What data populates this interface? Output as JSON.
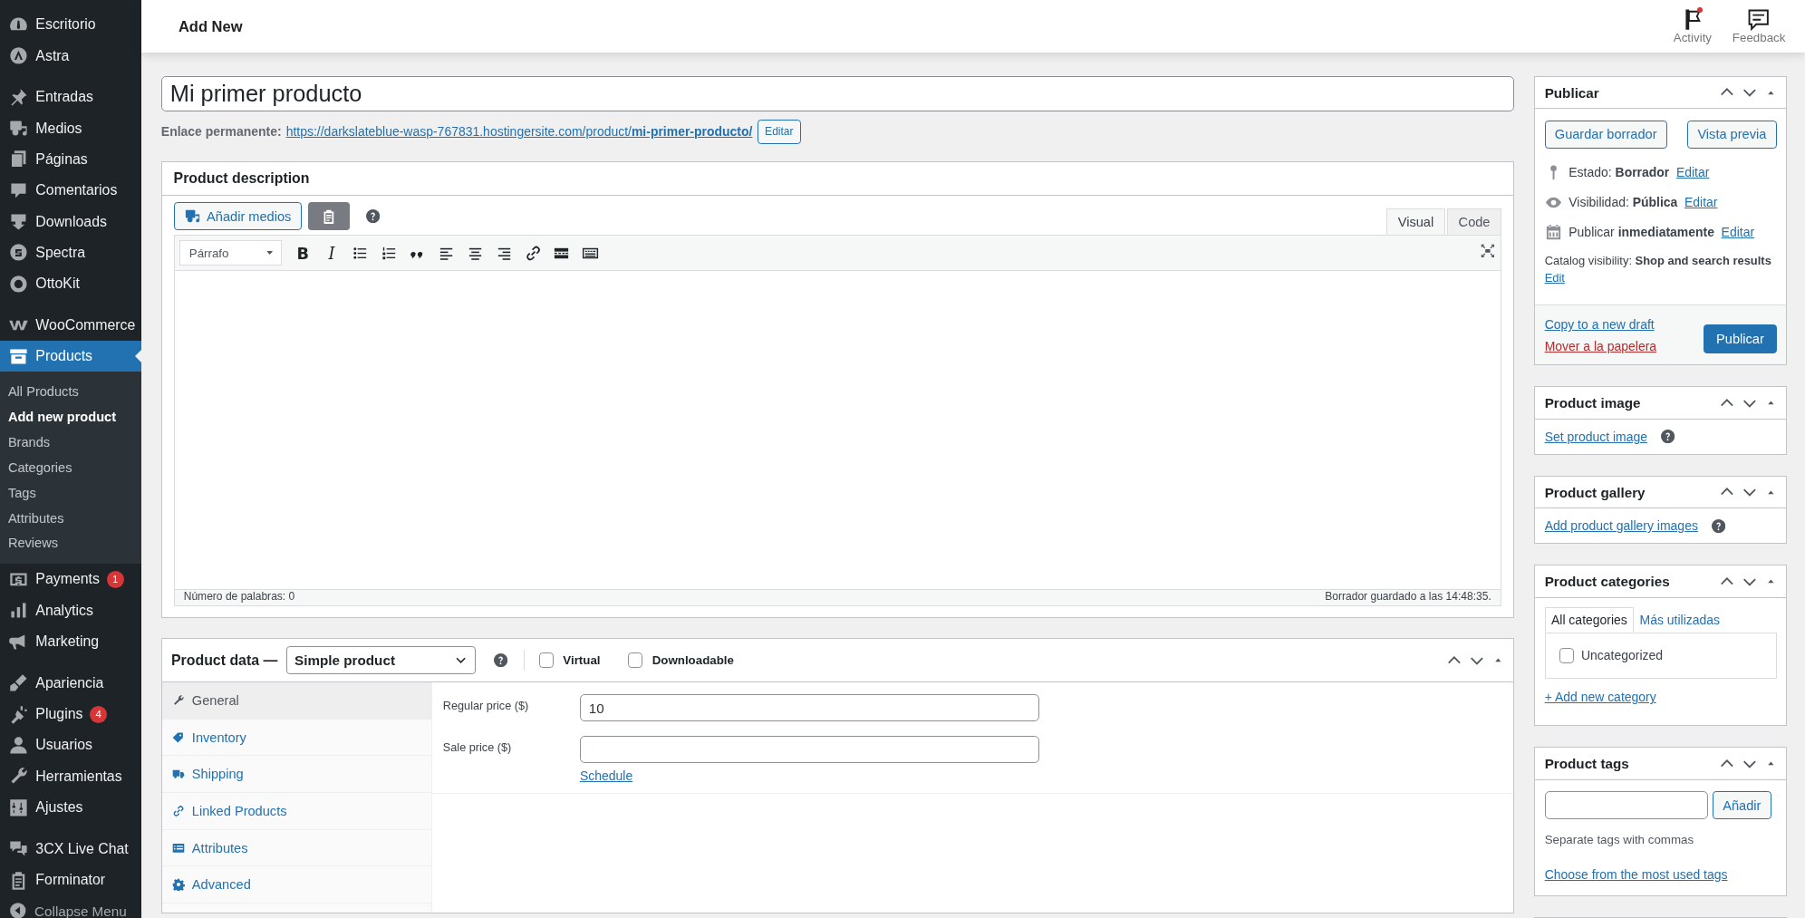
{
  "topbar": {
    "title": "Add New",
    "actions": [
      {
        "label": "Activity",
        "notification": true
      },
      {
        "label": "Feedback",
        "notification": false
      }
    ]
  },
  "sidebar": {
    "groups": [
      {
        "items": [
          {
            "label": "Escritorio",
            "selected": false
          },
          {
            "label": "Astra",
            "selected": false
          }
        ]
      },
      {
        "items": [
          {
            "label": "Entradas",
            "selected": false
          },
          {
            "label": "Medios",
            "selected": false
          },
          {
            "label": "Páginas",
            "selected": false
          },
          {
            "label": "Comentarios",
            "selected": false
          },
          {
            "label": "Downloads",
            "selected": false
          },
          {
            "label": "Spectra",
            "selected": false
          },
          {
            "label": "OttoKit",
            "selected": false
          }
        ]
      },
      {
        "items": [
          {
            "label": "WooCommerce",
            "selected": false
          },
          {
            "label": "Products",
            "selected": true,
            "children": [
              {
                "label": "All Products",
                "selected": false
              },
              {
                "label": "Add new product",
                "selected": true
              },
              {
                "label": "Brands",
                "selected": false
              },
              {
                "label": "Categories",
                "selected": false
              },
              {
                "label": "Tags",
                "selected": false
              },
              {
                "label": "Attributes",
                "selected": false
              },
              {
                "label": "Reviews",
                "selected": false
              }
            ]
          },
          {
            "label": "Payments",
            "selected": false,
            "badge": "1"
          },
          {
            "label": "Analytics",
            "selected": false
          },
          {
            "label": "Marketing",
            "selected": false
          }
        ]
      },
      {
        "items": [
          {
            "label": "Apariencia",
            "selected": false
          },
          {
            "label": "Plugins",
            "selected": false,
            "badge": "4"
          },
          {
            "label": "Usuarios",
            "selected": false
          },
          {
            "label": "Herramientas",
            "selected": false
          },
          {
            "label": "Ajustes",
            "selected": false
          }
        ]
      },
      {
        "items": [
          {
            "label": "3CX Live Chat",
            "selected": false
          },
          {
            "label": "Forminator",
            "selected": false
          }
        ]
      }
    ],
    "collapse": "Collapse Menu"
  },
  "title_field": {
    "value": "Mi primer producto"
  },
  "permalink": {
    "label": "Enlace permanente:",
    "url": "https://darkslateblue-wasp-767831.hostingersite.com/product/**mi-primer-producto/**",
    "button": "Editar"
  },
  "description": {
    "title": "Product description",
    "add_media": "Añadir medios",
    "tabs": [
      {
        "label": "Visual",
        "selected": true
      },
      {
        "label": "Code",
        "selected": false
      }
    ],
    "format": "Párrafo",
    "toolbar": [
      {
        "kind": "bold",
        "label": "B"
      },
      {
        "kind": "italic",
        "label": "I"
      },
      {
        "kind": "bullets"
      },
      {
        "kind": "numbers"
      },
      {
        "kind": "quote"
      },
      {
        "kind": "align-left"
      },
      {
        "kind": "align-center"
      },
      {
        "kind": "align-right"
      },
      {
        "kind": "link"
      },
      {
        "kind": "more"
      },
      {
        "kind": "toolbar"
      }
    ],
    "word_count": "Número de palabras: 0",
    "saved": "Borrador guardado a las 14:48:35."
  },
  "product_data": {
    "title": "Product data —",
    "type": "Simple product",
    "options": [
      {
        "label": "Virtual",
        "checked": false
      },
      {
        "label": "Downloadable",
        "checked": false
      }
    ],
    "tabs": [
      {
        "label": "General",
        "selected": true
      },
      {
        "label": "Inventory",
        "selected": false
      },
      {
        "label": "Shipping",
        "selected": false
      },
      {
        "label": "Linked Products",
        "selected": false
      },
      {
        "label": "Attributes",
        "selected": false
      },
      {
        "label": "Advanced",
        "selected": false
      }
    ],
    "fields": [
      {
        "label": "Regular price ($)",
        "value": "10"
      },
      {
        "label": "Sale price ($)",
        "link": "Schedule"
      }
    ]
  },
  "publish": {
    "title": "Publicar",
    "save_draft": "Guardar borrador",
    "preview": "Vista previa",
    "rows": [
      {
        "kind": "status",
        "text": "Estado: **Borrador**",
        "link": "Editar"
      },
      {
        "kind": "visibility",
        "text": "Visibilidad: **Pública**",
        "link": "Editar"
      },
      {
        "kind": "schedule",
        "text": "Publicar **inmediatamente**",
        "link": "Editar"
      },
      {
        "kind": "catalog",
        "text": "Catalog visibility: **Shop and search results**",
        "link": "Edit"
      }
    ],
    "copy_link": "Copy to a new draft",
    "trash_link": "Mover a la papelera",
    "publish_button": "Publicar"
  },
  "product_image": {
    "title": "Product image",
    "link": "Set product image"
  },
  "product_gallery": {
    "title": "Product gallery",
    "link": "Add product gallery images"
  },
  "product_categories": {
    "title": "Product categories",
    "tabs": [
      {
        "label": "All categories",
        "selected": true
      },
      {
        "label": "Más utilizadas",
        "selected": false
      }
    ],
    "categories": [
      {
        "label": "Uncategorized",
        "checked": false
      }
    ],
    "add_link": "+ Add new category"
  },
  "product_tags": {
    "title": "Product tags",
    "add_button": "Añadir",
    "hint": "Separate tags with commas",
    "choose_link": "Choose from the most used tags"
  }
}
